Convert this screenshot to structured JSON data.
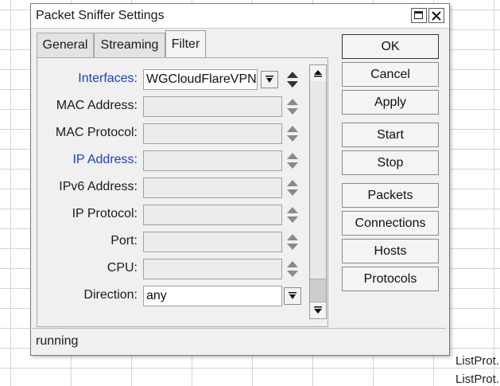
{
  "window": {
    "title": "Packet Sniffer Settings"
  },
  "tabs": [
    {
      "label": "General",
      "active": false
    },
    {
      "label": "Streaming",
      "active": false
    },
    {
      "label": "Filter",
      "active": true
    }
  ],
  "filter_rows": [
    {
      "label": "Interfaces:",
      "value": "WGCloudFlareVPN",
      "highlight": true
    },
    {
      "label": "MAC Address:",
      "value": ""
    },
    {
      "label": "MAC Protocol:",
      "value": ""
    },
    {
      "label": "IP Address:",
      "value": "",
      "highlight": true
    },
    {
      "label": "IPv6 Address:",
      "value": ""
    },
    {
      "label": "IP Protocol:",
      "value": ""
    },
    {
      "label": "Port:",
      "value": ""
    },
    {
      "label": "CPU:",
      "value": ""
    },
    {
      "label": "Direction:",
      "value": "any"
    }
  ],
  "buttons": {
    "ok": "OK",
    "cancel": "Cancel",
    "apply": "Apply",
    "start": "Start",
    "stop": "Stop",
    "packets": "Packets",
    "connections": "Connections",
    "hosts": "Hosts",
    "protocols": "Protocols"
  },
  "status": "running",
  "background_sheet": {
    "cells": [
      "ListProt.",
      "ListProt."
    ]
  },
  "colors": {
    "highlight_label": "#1e3cc8"
  }
}
